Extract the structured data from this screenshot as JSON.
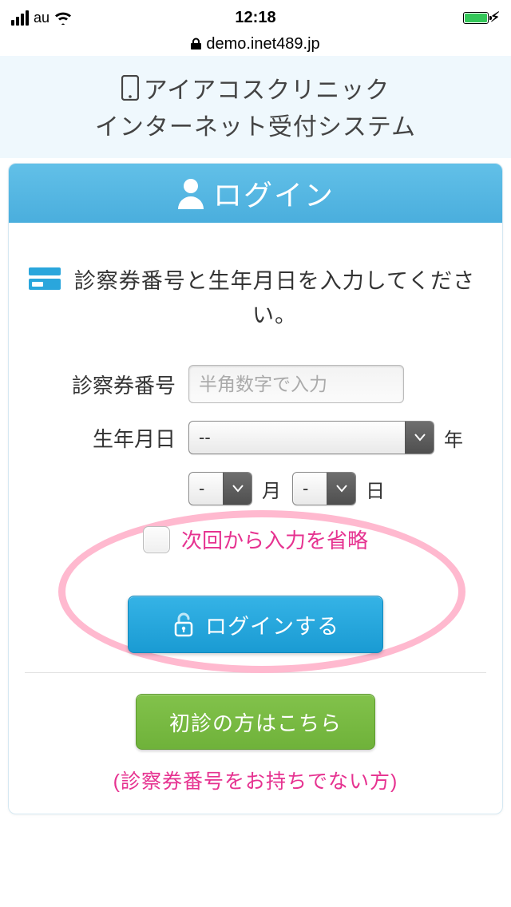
{
  "status": {
    "carrier": "au",
    "time": "12:18"
  },
  "url": "demo.inet489.jp",
  "page": {
    "clinic": "アイアコスクリニック",
    "subtitle": "インターネット受付システム"
  },
  "card": {
    "title": "ログイン",
    "instruction": "診察券番号と生年月日を入力してください。",
    "field_card_number_label": "診察券番号",
    "field_card_number_placeholder": "半角数字で入力",
    "field_birth_label": "生年月日",
    "year_value": "--",
    "year_unit": "年",
    "month_value": "-",
    "month_unit": "月",
    "day_value": "-",
    "day_unit": "日",
    "remember_label": "次回から入力を省略",
    "login_button": "ログインする",
    "first_visit_button": "初診の方はこちら",
    "note": "(診察券番号をお持ちでない方)"
  }
}
